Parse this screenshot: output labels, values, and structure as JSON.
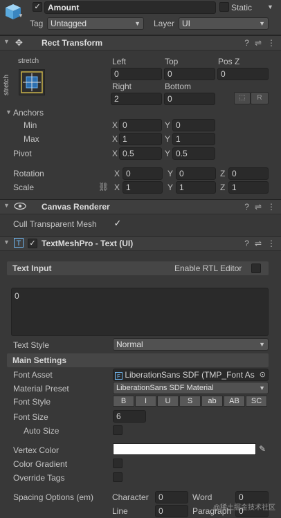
{
  "gameobject": {
    "active_checked": "✓",
    "name": "Amount",
    "static_label": "Static",
    "tag_label": "Tag",
    "tag_value": "Untagged",
    "layer_label": "Layer",
    "layer_value": "UI"
  },
  "rect_transform": {
    "title": "Rect Transform",
    "anchor_preset_top": "stretch",
    "anchor_preset_side": "stretch",
    "left_label": "Left",
    "left_value": "0",
    "top_label": "Top",
    "top_value": "0",
    "posz_label": "Pos Z",
    "posz_value": "0",
    "right_label": "Right",
    "right_value": "2",
    "bottom_label": "Bottom",
    "bottom_value": "0",
    "r_button": "R",
    "anchors_label": "Anchors",
    "min_label": "Min",
    "min_x": "0",
    "min_y": "0",
    "max_label": "Max",
    "max_x": "1",
    "max_y": "1",
    "pivot_label": "Pivot",
    "pivot_x": "0.5",
    "pivot_y": "0.5",
    "rotation_label": "Rotation",
    "rot_x": "0",
    "rot_y": "0",
    "rot_z": "0",
    "scale_label": "Scale",
    "scale_x": "1",
    "scale_y": "1",
    "scale_z": "1",
    "axis_x": "X",
    "axis_y": "Y",
    "axis_z": "Z"
  },
  "canvas_renderer": {
    "title": "Canvas Renderer",
    "cull_label": "Cull Transparent Mesh",
    "cull_checked": "✓"
  },
  "textmeshpro": {
    "title": "TextMeshPro - Text (UI)",
    "enabled_checked": "✓",
    "text_input_title": "Text Input",
    "rtl_label": "Enable RTL Editor",
    "text_value": "0",
    "text_style_label": "Text Style",
    "text_style_value": "Normal",
    "main_settings_title": "Main Settings",
    "font_asset_label": "Font Asset",
    "font_asset_value": "LiberationSans SDF (TMP_Font As",
    "material_preset_label": "Material Preset",
    "material_preset_value": "LiberationSans SDF Material",
    "font_style_label": "Font Style",
    "font_style_buttons": [
      "B",
      "I",
      "U",
      "S",
      "ab",
      "AB",
      "SC"
    ],
    "font_size_label": "Font Size",
    "font_size_value": "6",
    "auto_size_label": "Auto Size",
    "vertex_color_label": "Vertex Color",
    "vertex_color": "#ffffff",
    "color_gradient_label": "Color Gradient",
    "override_tags_label": "Override Tags",
    "spacing_label": "Spacing Options (em)",
    "character_label": "Character",
    "character_value": "0",
    "word_label": "Word",
    "word_value": "0",
    "line_label": "Line",
    "line_value": "0",
    "paragraph_label": "Paragraph",
    "paragraph_value": "0"
  },
  "watermark": "@稀土掘金技术社区",
  "icons": {
    "cube": "cube-icon",
    "move": "move-arrows-icon",
    "eye": "eye-icon",
    "tmp": "text-icon",
    "help": "help-icon",
    "presets": "presets-icon",
    "more": "more-vertical-icon",
    "link": "link-icon",
    "eyedropper": "eyedropper-icon",
    "target": "object-picker-icon"
  }
}
